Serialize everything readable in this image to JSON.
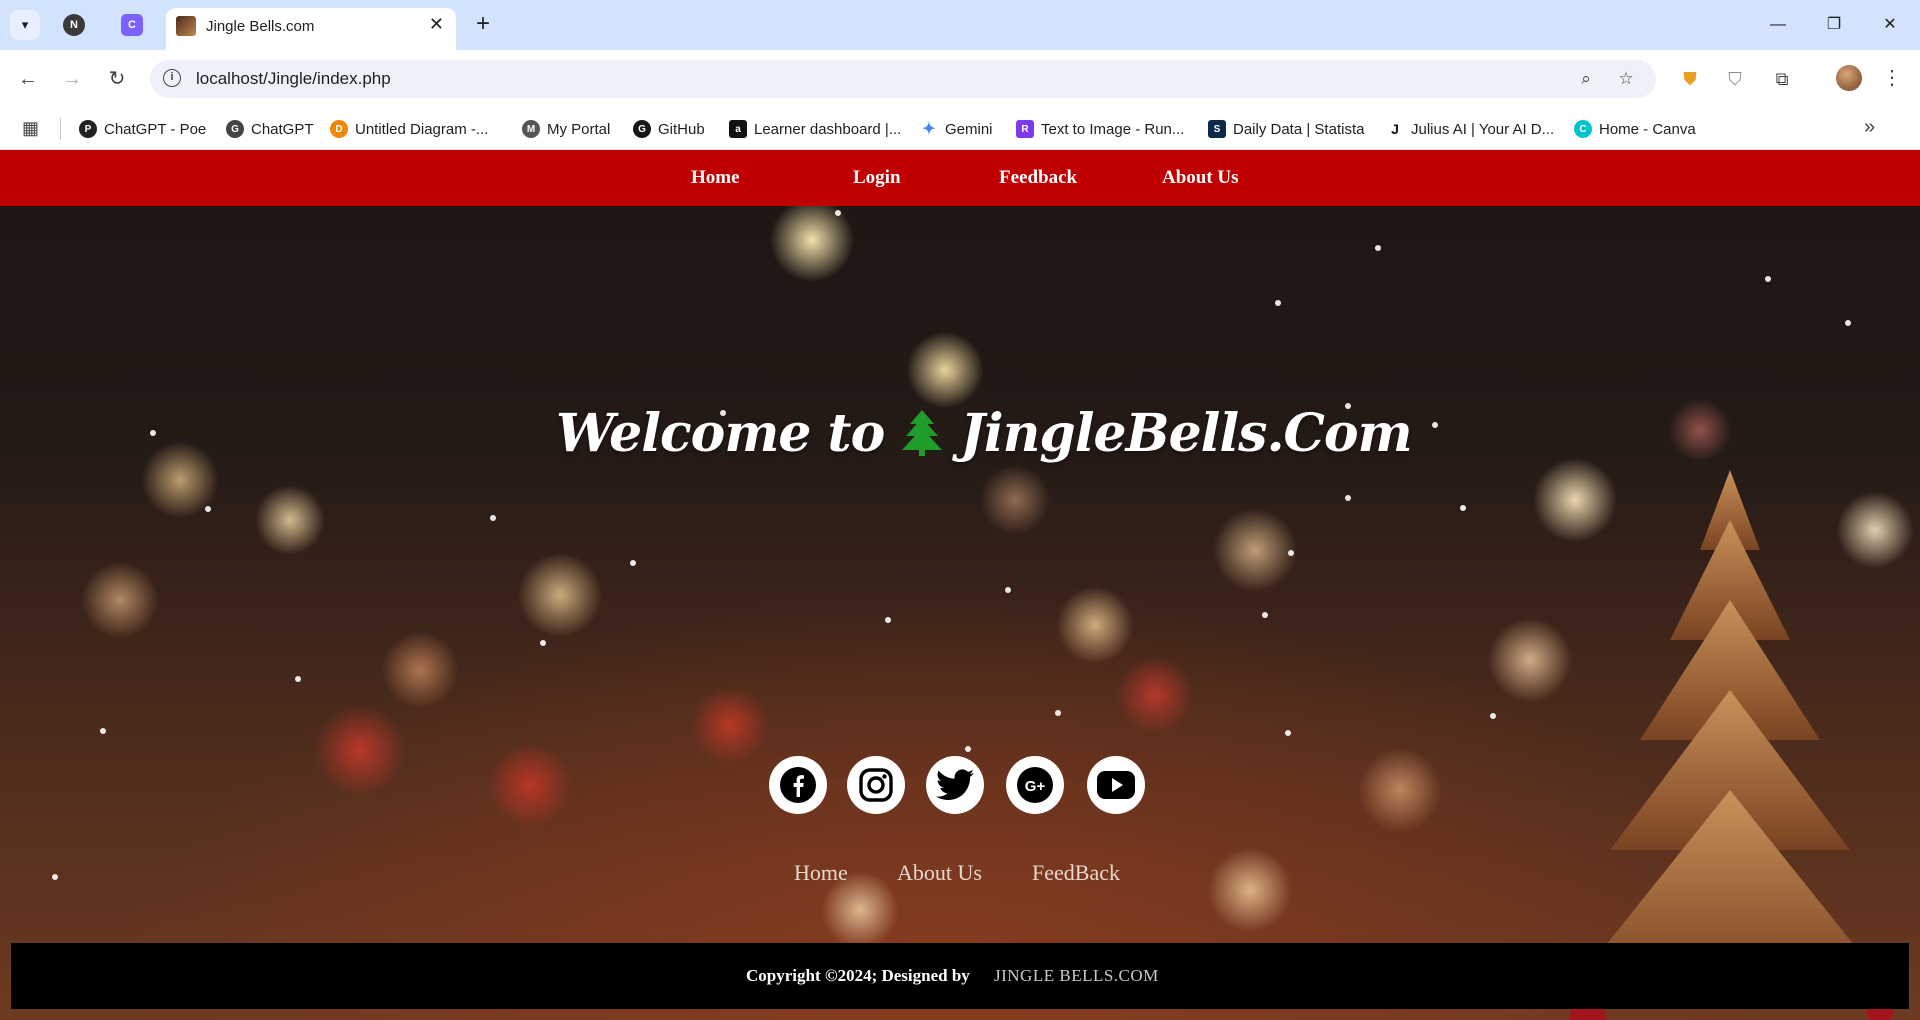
{
  "browser": {
    "active_tab_title": "Jingle Bells.com",
    "url": "localhost/Jingle/index.php",
    "bookmarks": [
      {
        "label": "ChatGPT - Poe",
        "icon": "poe-icon",
        "color": "#222222"
      },
      {
        "label": "ChatGPT",
        "icon": "chatgpt-icon",
        "color": "#444444"
      },
      {
        "label": "Untitled Diagram -...",
        "icon": "diagram-icon",
        "color": "#f08705"
      },
      {
        "label": "My Portal",
        "icon": "portal-icon",
        "color": "#555555"
      },
      {
        "label": "GitHub",
        "icon": "github-icon",
        "color": "#181717"
      },
      {
        "label": "Learner dashboard |...",
        "icon": "alx-icon",
        "color": "#111111"
      },
      {
        "label": "Gemini",
        "icon": "gemini-icon",
        "color": "#4285f4"
      },
      {
        "label": "Text to Image - Run...",
        "icon": "runway-icon",
        "color": "#7c3aed"
      },
      {
        "label": "Daily Data | Statista",
        "icon": "statista-icon",
        "color": "#0b2a4a"
      },
      {
        "label": "Julius AI | Your AI D...",
        "icon": "julius-icon",
        "color": "#111111"
      },
      {
        "label": "Home - Canva",
        "icon": "canva-icon",
        "color": "#00c4cc"
      }
    ]
  },
  "nav": {
    "home": "Home",
    "login": "Login",
    "feedback": "Feedback",
    "about": "About Us"
  },
  "hero": {
    "welcome_prefix": "Welcome to",
    "brand": "JingleBells.Com",
    "tree_icon": "christmas-tree-icon"
  },
  "socials": [
    "facebook-icon",
    "instagram-icon",
    "twitter-icon",
    "google-plus-icon",
    "youtube-icon"
  ],
  "footer": {
    "links": {
      "home": "Home",
      "about": "About Us",
      "feedback": "FeedBack"
    },
    "copyright": "Copyright ©2024; Designed by",
    "brand": "JINGLE BELLS.COM"
  },
  "colors": {
    "nav_bg": "#c00000",
    "footer_bg": "#000000",
    "tree_green": "#1f9d2b"
  }
}
